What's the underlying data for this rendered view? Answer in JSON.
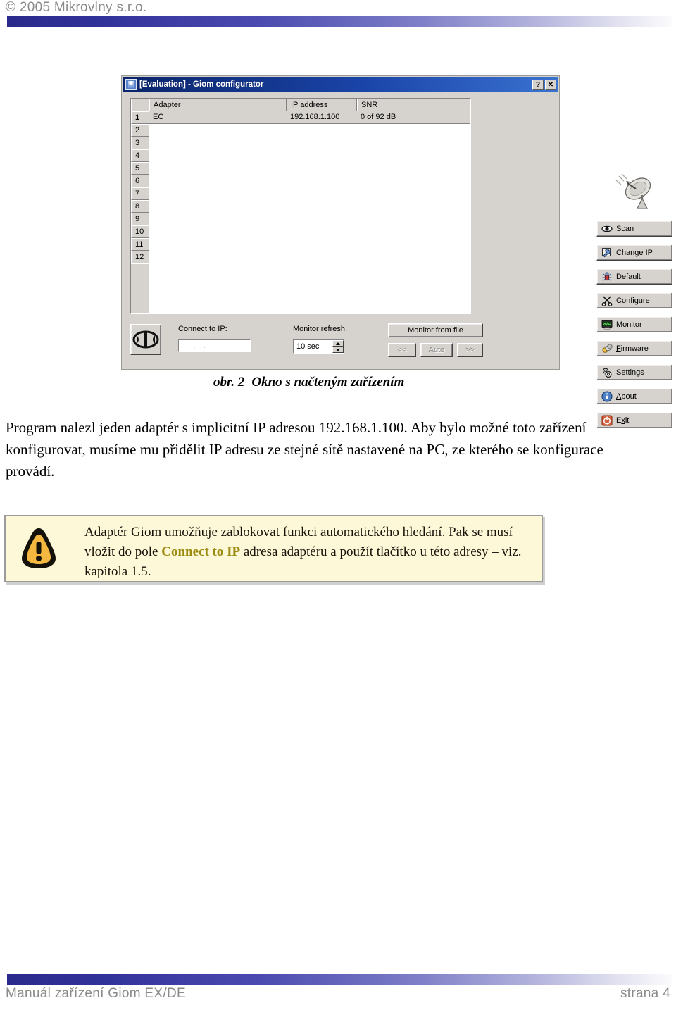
{
  "header": {
    "copyright": "© 2005 Mikrovlny  s.r.o."
  },
  "figure": {
    "caption_number": "obr. 2",
    "caption_text": "Okno s načteným zařízením",
    "dialog": {
      "title": "[Evaluation] - Giom configurator",
      "titlebar_icon": "app-icon",
      "help_button": "?",
      "close_button": "✕",
      "decorative_icon": "satellite-dish-icon",
      "list": {
        "columns": [
          "",
          "Adapter",
          "IP address",
          "SNR"
        ],
        "rows": [
          {
            "num": "1",
            "adapter": "EC",
            "ip": "192.168.1.100",
            "snr": "0 of 92 dB"
          }
        ],
        "empty_row_numbers": [
          "2",
          "3",
          "4",
          "5",
          "6",
          "7",
          "8",
          "9",
          "10",
          "11",
          "12"
        ]
      },
      "side_buttons": [
        {
          "label": "Scan",
          "accel": "S",
          "icon": "eye-icon"
        },
        {
          "label": "Change IP",
          "accel": "",
          "icon": "wrench-icon"
        },
        {
          "label": "Default",
          "accel": "D",
          "icon": "bug-icon"
        },
        {
          "label": "Configure",
          "accel": "C",
          "icon": "scissors-icon"
        },
        {
          "label": "Monitor",
          "accel": "M",
          "icon": "monitor-icon"
        },
        {
          "label": "Firmware",
          "accel": "F",
          "icon": "chip-icon"
        },
        {
          "label": "Settings",
          "accel": "g",
          "icon": "gears-icon"
        },
        {
          "label": "About",
          "accel": "A",
          "icon": "info-icon"
        },
        {
          "label": "Exit",
          "accel": "x",
          "icon": "power-icon"
        }
      ],
      "bottom": {
        "connect_icon": "connector-icon",
        "connect_label": "Connect to IP:",
        "connect_value": ". . .",
        "connect_placeholder": ". . .",
        "refresh_label": "Monitor refresh:",
        "refresh_value": "10 sec",
        "monitor_from_file": "Monitor from file",
        "nav_prev": "<<",
        "nav_auto": "Auto",
        "nav_next": ">>"
      }
    }
  },
  "body": {
    "paragraph": "Program nalezl jeden adaptér s implicitní IP adresou 192.168.1.100. Aby bylo možné toto zařízení konfigurovat, musíme mu přidělit IP adresu ze stejné sítě nastavené na PC, ze kterého se konfigurace provádí."
  },
  "note": {
    "icon": "warning-triangle-icon",
    "part1": "Adaptér Giom umožňuje zablokovat funkci automatického hledání. Pak se musí vložit do pole ",
    "highlight": "Connect to IP",
    "part2": " adresa adaptéru a použít tlačítko u této adresy – viz. kapitola 1.5."
  },
  "footer": {
    "left": "Manuál zařízení Giom EX/DE",
    "right": "strana 4"
  }
}
